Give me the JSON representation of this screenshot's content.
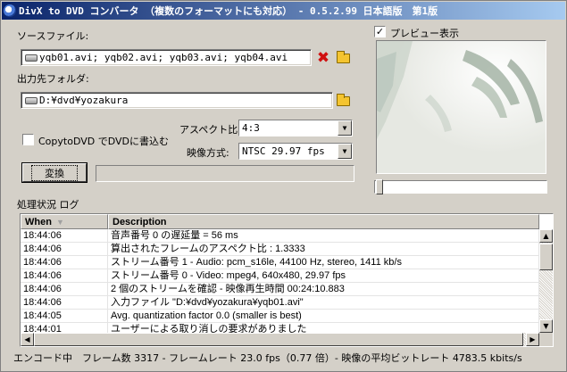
{
  "window": {
    "title": "DivX to DVD コンバータ （複数のフォーマットにも対応） - 0.5.2.99 日本語版　第1版"
  },
  "source": {
    "label": "ソースファイル:",
    "value": "yqb01.avi; yqb02.avi; yqb03.avi; yqb04.avi"
  },
  "output": {
    "label": "出力先フォルダ:",
    "value": "D:¥dvd¥yozakura"
  },
  "copy_to_dvd": {
    "label": "CopytoDVD でDVDに書込む",
    "checked": false
  },
  "aspect": {
    "label": "アスペクト比:",
    "value": "4:3"
  },
  "video_format": {
    "label": "映像方式:",
    "value": "NTSC 29.97 fps"
  },
  "convert_button": "変換",
  "preview": {
    "label": "プレビュー表示",
    "checked": true
  },
  "log": {
    "label": "処理状況 ログ",
    "columns": [
      "When",
      "Description"
    ],
    "rows": [
      [
        "18:44:06",
        "音声番号 0 の遅延量 = 56 ms"
      ],
      [
        "18:44:06",
        "算出されたフレームのアスペクト比 : 1.3333"
      ],
      [
        "18:44:06",
        "ストリーム番号 1 - Audio: pcm_s16le, 44100 Hz, stereo, 1411 kb/s"
      ],
      [
        "18:44:06",
        "ストリーム番号 0 - Video: mpeg4, 640x480, 29.97 fps"
      ],
      [
        "18:44:06",
        "2 個のストリームを確認 - 映像再生時間 00:24:10.883"
      ],
      [
        "18:44:06",
        "入力ファイル \"D:¥dvd¥yozakura¥yqb01.avi\""
      ],
      [
        "18:44:05",
        "Avg. quantization factor 0.0 (smaller is best)"
      ],
      [
        "18:44:01",
        "ユーザーによる取り消しの要求がありました"
      ]
    ]
  },
  "status": "エンコード中　フレーム数 3317 - フレームレート 23.0 fps（0.77 倍）- 映像の平均ビットレート 4783.5 kbits/s",
  "colors": {
    "title_gradient_start": "#0a246a",
    "title_gradient_end": "#a6caf0",
    "face": "#d4d0c8",
    "delete_icon": "#d01010",
    "folder_icon": "#f4c430"
  },
  "icons": [
    "app-icon",
    "drive-icon",
    "delete-icon",
    "folder-icon",
    "sort-down-icon",
    "scroll-up-icon",
    "scroll-down-icon",
    "scroll-left-icon",
    "scroll-right-icon"
  ]
}
